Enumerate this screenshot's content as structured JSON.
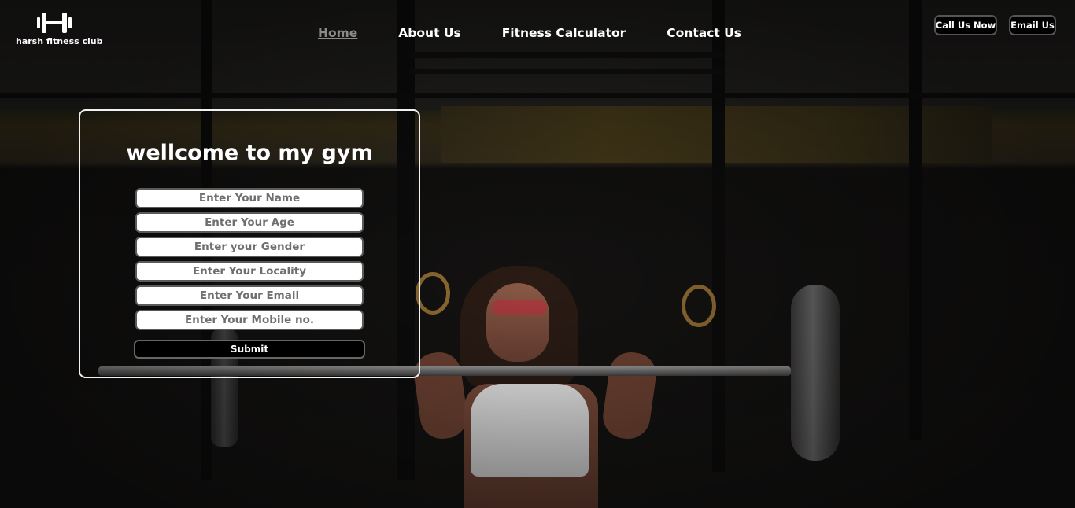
{
  "brand": {
    "name": "harsh fitness club",
    "icon": "dumbbell-icon"
  },
  "nav": {
    "items": [
      {
        "label": "Home",
        "active": true
      },
      {
        "label": "About Us",
        "active": false
      },
      {
        "label": "Fitness Calculator",
        "active": false
      },
      {
        "label": "Contact Us",
        "active": false
      }
    ]
  },
  "header_buttons": {
    "call_label": "Call Us Now",
    "email_label": "Email Us"
  },
  "form": {
    "title": "wellcome to my gym",
    "fields": [
      {
        "placeholder": "Enter Your Name"
      },
      {
        "placeholder": "Enter Your Age"
      },
      {
        "placeholder": "Enter your Gender"
      },
      {
        "placeholder": "Enter Your Locality"
      },
      {
        "placeholder": "Enter Your Email"
      },
      {
        "placeholder": "Enter Your Mobile no."
      }
    ],
    "submit_label": "Submit"
  },
  "colors": {
    "nav_active": "#8a8a8a",
    "card_border": "#f2f2f2",
    "button_bg": "#000000"
  }
}
